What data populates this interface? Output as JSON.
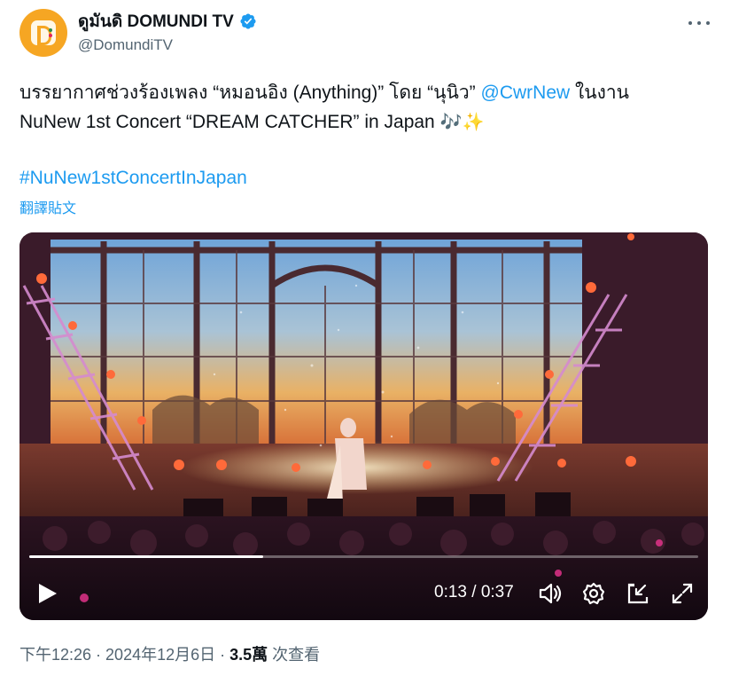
{
  "author": {
    "display_name": "ดูมันดิ DOMUNDI TV",
    "handle": "@DomundiTV",
    "verified": true
  },
  "tweet": {
    "line1_text": "บรรยากาศช่วงร้องเพลง “หมอนอิง (Anything)” โดย “นุนิว” ",
    "mention": "@CwrNew",
    "line1_tail": " ในงาน",
    "line2_text": "NuNew 1st Concert “DREAM CATCHER” in Japan ",
    "emoji_notes": "🎶",
    "emoji_sparkles": "✨",
    "hashtag": "#NuNew1stConcertInJapan",
    "translate_label": "翻譯貼文"
  },
  "video": {
    "progress": 0.35,
    "current_time": "0:13",
    "separator": " / ",
    "duration": "0:37",
    "icons": [
      "play-icon",
      "volume-icon",
      "settings-icon",
      "popout-icon",
      "fullscreen-icon"
    ]
  },
  "meta": {
    "time": "下午12:26",
    "dot1": " · ",
    "date": "2024年12月6日",
    "dot2": " · ",
    "views": "3.5萬",
    "views_label": " 次查看"
  },
  "colors": {
    "accent": "#1d9bf0",
    "text": "#0f1419",
    "secondary": "#536471",
    "avatar_bg": "#f6a623"
  }
}
